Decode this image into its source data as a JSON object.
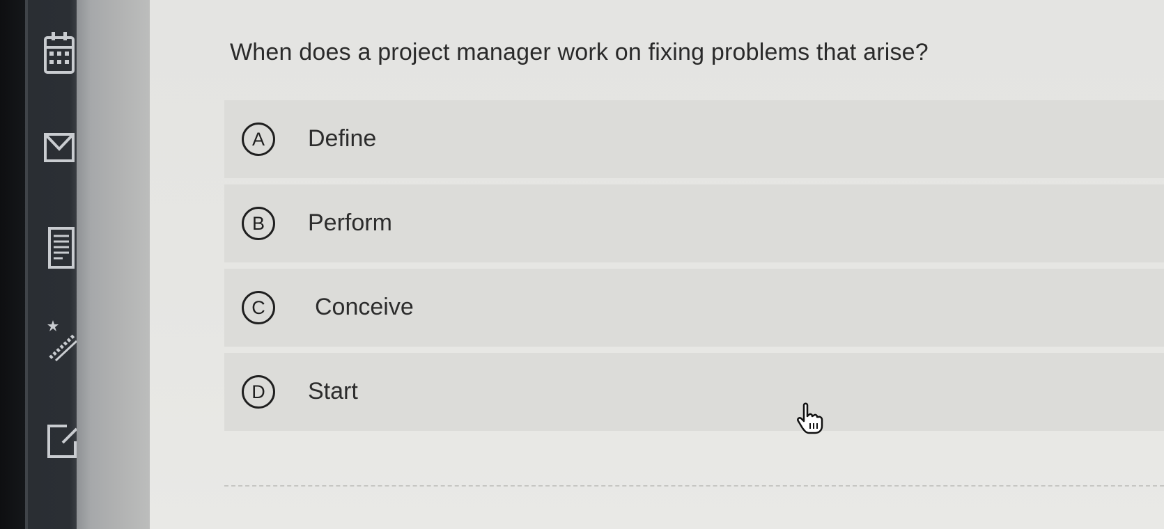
{
  "sidebar": {
    "icons": [
      "calendar-icon",
      "mail-icon",
      "document-icon",
      "tools-icon",
      "edit-icon"
    ]
  },
  "question": {
    "text": "When does a project manager work on fixing problems that arise?"
  },
  "options": [
    {
      "letter": "A",
      "label": "Define"
    },
    {
      "letter": "B",
      "label": "Perform"
    },
    {
      "letter": "C",
      "label": "Conceive"
    },
    {
      "letter": "D",
      "label": "Start"
    }
  ],
  "colors": {
    "option_background": "#dcdcd9",
    "content_background": "#e4e4e2",
    "text": "#2a2a2a"
  }
}
